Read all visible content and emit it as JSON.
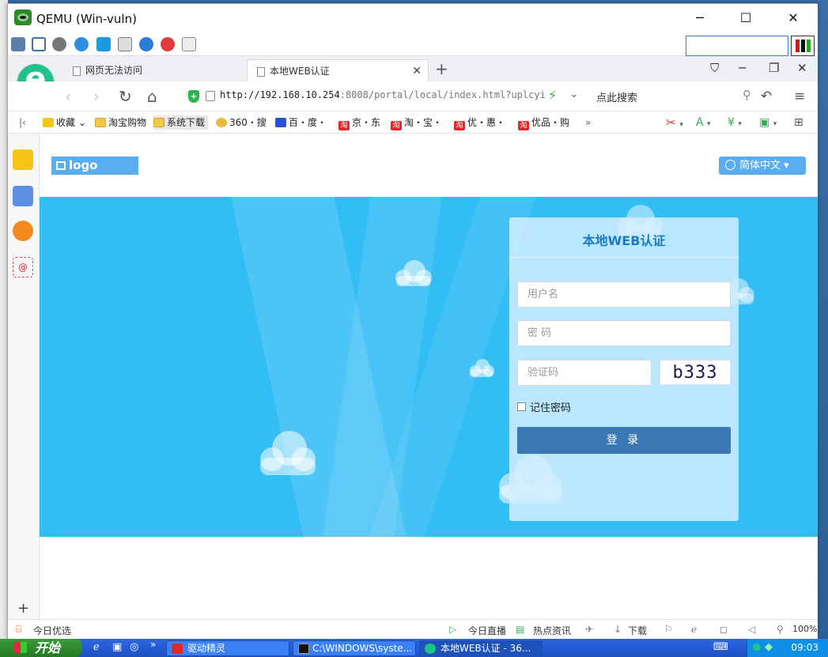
{
  "window": {
    "title": "QEMU (Win-vuln)",
    "minimize": "─",
    "maximize": "☐",
    "close": "✕"
  },
  "browser": {
    "tabs": [
      {
        "label": "网页无法访问"
      },
      {
        "label": "本地WEB认证",
        "close": "✕"
      }
    ],
    "new_tab": "+",
    "url_host": "http://192.168.10.254",
    "url_rest": ":8008/portal/local/index.html?uplcyi",
    "search_placeholder": "点此搜索",
    "bookmarks": [
      {
        "label": "收藏",
        "icon": "star-icon"
      },
      {
        "label": "淘宝购物",
        "icon": "folder-icon"
      },
      {
        "label": "系统下载",
        "icon": "folder-icon"
      },
      {
        "label": "360・搜",
        "icon": "360-icon"
      },
      {
        "label": "百・度・",
        "icon": "baidu-icon"
      },
      {
        "label": "京・东",
        "icon": "taobao-icon"
      },
      {
        "label": "淘・宝・",
        "icon": "taobao-icon"
      },
      {
        "label": "优・惠・",
        "icon": "taobao-icon"
      },
      {
        "label": "优品・购",
        "icon": "taobao-icon"
      }
    ],
    "bookmarks_more": "»"
  },
  "page": {
    "logo": "logo",
    "language": "简体中文 ▾",
    "login": {
      "title": "本地WEB认证",
      "username_placeholder": "用户名",
      "password_placeholder": "密 码",
      "captcha_placeholder": "验证码",
      "captcha_text": "b333",
      "remember": "记住密码",
      "submit": "登 录"
    }
  },
  "statusbar": {
    "left": "今日优选",
    "live": "今日直播",
    "news": "热点资讯",
    "download": "下载",
    "zoom": "100%"
  },
  "taskbar": {
    "start": "开始",
    "tasks": [
      {
        "label": "驱动精灵"
      },
      {
        "label": "C:\\WINDOWS\\syste..."
      },
      {
        "label": "本地WEB认证 - 36..."
      }
    ],
    "clock": "09:03"
  },
  "colors": {
    "hero": "#33bdf5",
    "login_button": "#3a77b4",
    "logo_bg": "#5aaef0",
    "title_text": "#1c7cc0"
  }
}
